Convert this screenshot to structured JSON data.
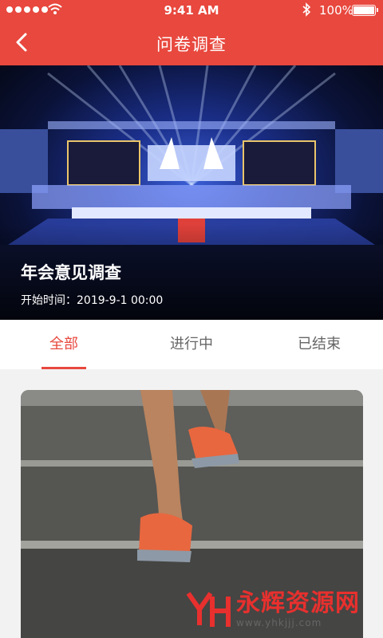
{
  "status_bar": {
    "time": "9:41 AM",
    "battery": "100%"
  },
  "nav": {
    "title": "问卷调查"
  },
  "banner": {
    "title": "年会意见调查",
    "start_time": "开始时间：2019-9-1 00:00"
  },
  "tabs": [
    {
      "label": "全部",
      "active": true
    },
    {
      "label": "进行中",
      "active": false
    },
    {
      "label": "已结束",
      "active": false
    }
  ],
  "watermark": {
    "name": "永辉资源网",
    "url": "www.yhkjjj.com"
  },
  "colors": {
    "brand": "#e8483e"
  }
}
